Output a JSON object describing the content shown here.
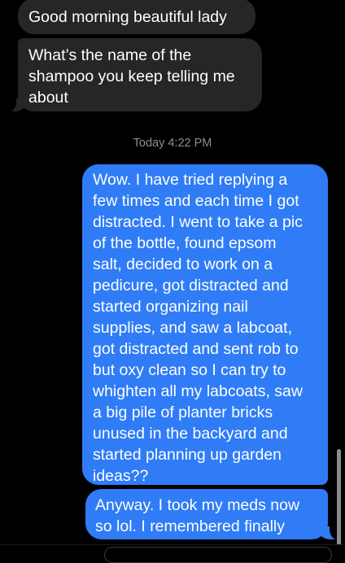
{
  "conversation": {
    "messages": [
      {
        "id": "m1",
        "direction": "incoming",
        "text": "Good morning beautiful lady"
      },
      {
        "id": "m2",
        "direction": "incoming",
        "text": "What’s the name of the\nshampoo you keep telling me\nabout"
      },
      {
        "id": "m3",
        "direction": "outgoing",
        "text": "Wow. I have tried replying a\nfew times and each time I got\ndistracted. I went to take a pic\nof the bottle, found epsom\nsalt, decided to work on a\npedicure, got distracted and\nstarted organizing nail\nsupplies, and saw a labcoat,\ngot distracted and sent rob to\nbut oxy clean so I can try to\nwhighten all my labcoats, saw\na big pile of planter bricks\nunused in the backyard and\nstarted planning up garden\nideas??"
      },
      {
        "id": "m4",
        "direction": "outgoing",
        "text": "Anyway. I took my meds now\nso lol. I remembered finally"
      }
    ],
    "timestamp": "Today 4:22 PM"
  },
  "colors": {
    "background": "#000000",
    "incoming_bubble": "#262629",
    "outgoing_bubble": "#2f7cf6",
    "timestamp_text": "#8e8e93"
  }
}
